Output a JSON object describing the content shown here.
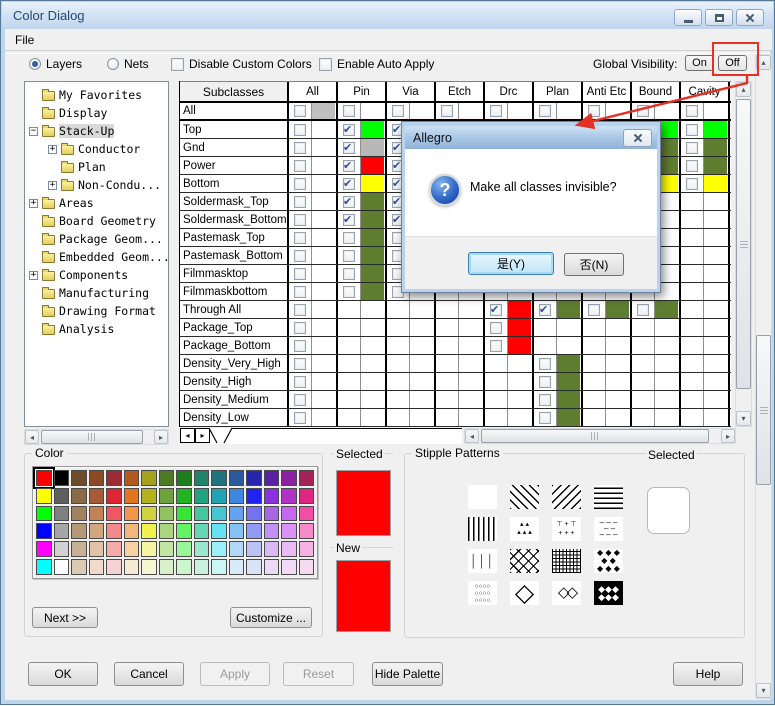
{
  "window": {
    "title": "Color Dialog",
    "menu": [
      "File"
    ]
  },
  "toolbar": {
    "radios": [
      {
        "label": "Layers",
        "selected": true
      },
      {
        "label": "Nets",
        "selected": false
      }
    ],
    "checkboxes": [
      {
        "label": "Disable Custom Colors",
        "checked": false
      },
      {
        "label": "Enable Auto Apply",
        "checked": false
      }
    ],
    "global_visibility_label": "Global Visibility:",
    "on_label": "On",
    "off_label": "Off"
  },
  "tree": {
    "items": [
      {
        "label": "My Favorites",
        "level": 0,
        "expand": null,
        "open": false,
        "selected": false
      },
      {
        "label": "Display",
        "level": 0,
        "expand": null,
        "open": false,
        "selected": false
      },
      {
        "label": "Stack-Up",
        "level": 0,
        "expand": "minus",
        "open": true,
        "selected": true
      },
      {
        "label": "Conductor",
        "level": 1,
        "expand": "plus",
        "open": false,
        "selected": false
      },
      {
        "label": "Plan",
        "level": 1,
        "expand": null,
        "open": false,
        "selected": false
      },
      {
        "label": "Non-Condu...",
        "level": 1,
        "expand": "plus",
        "open": false,
        "selected": false
      },
      {
        "label": "Areas",
        "level": 0,
        "expand": "plus",
        "open": false,
        "selected": false
      },
      {
        "label": "Board Geometry",
        "level": 0,
        "expand": null,
        "open": false,
        "selected": false
      },
      {
        "label": "Package Geom...",
        "level": 0,
        "expand": null,
        "open": false,
        "selected": false
      },
      {
        "label": "Embedded Geom...",
        "level": 0,
        "expand": null,
        "open": false,
        "selected": false
      },
      {
        "label": "Components",
        "level": 0,
        "expand": "plus",
        "open": false,
        "selected": false
      },
      {
        "label": "Manufacturing",
        "level": 0,
        "expand": null,
        "open": false,
        "selected": false
      },
      {
        "label": "Drawing Format",
        "level": 0,
        "expand": null,
        "open": false,
        "selected": false
      },
      {
        "label": "Analysis",
        "level": 0,
        "expand": null,
        "open": false,
        "selected": false
      }
    ]
  },
  "table": {
    "corner_header": "Subclasses",
    "columns": [
      "All",
      "Pin",
      "Via",
      "Etch",
      "Drc",
      "Plan",
      "Anti Etc",
      "Bound",
      "Cavity"
    ],
    "rows": [
      {
        "label": "All",
        "cells": {
          "All": [
            "u",
            "#c0c0c0"
          ],
          "Pin": [
            "u",
            null
          ],
          "Via": [
            "u",
            null
          ],
          "Etch": [
            "u",
            null
          ],
          "Drc": [
            "u",
            null
          ],
          "Plan": [
            "u",
            null
          ],
          "Anti Etc": [
            "u",
            null
          ],
          "Bound": [
            "u",
            null
          ],
          "Cavity": [
            "u",
            null
          ]
        }
      },
      {
        "label": "Top",
        "cells": {
          "All": [
            "u",
            null
          ],
          "Pin": [
            "c",
            "#00ff00"
          ],
          "Via": [
            "c",
            null
          ],
          "Bound": [
            null,
            "#00ff00"
          ],
          "Cavity": [
            "u",
            "#00ff00"
          ]
        }
      },
      {
        "label": "Gnd",
        "cells": {
          "All": [
            "u",
            null
          ],
          "Pin": [
            "c",
            "#b8b8b8"
          ],
          "Via": [
            "c",
            null
          ],
          "Bound": [
            null,
            "#5f7d2f"
          ],
          "Cavity": [
            "u",
            "#5f7d2f"
          ]
        }
      },
      {
        "label": "Power",
        "cells": {
          "All": [
            "u",
            null
          ],
          "Pin": [
            "c",
            "#ff0000"
          ],
          "Via": [
            "c",
            null
          ],
          "Bound": [
            null,
            "#5f7d2f"
          ],
          "Cavity": [
            "u",
            "#5f7d2f"
          ]
        }
      },
      {
        "label": "Bottom",
        "cells": {
          "All": [
            "u",
            null
          ],
          "Pin": [
            "c",
            "#ffff00"
          ],
          "Via": [
            "c",
            null
          ],
          "Bound": [
            null,
            "#ffff00"
          ],
          "Cavity": [
            "u",
            "#ffff00"
          ]
        }
      },
      {
        "label": "Soldermask_Top",
        "cells": {
          "All": [
            "u",
            null
          ],
          "Pin": [
            "c",
            "#5f7d2f"
          ],
          "Via": [
            "c",
            null
          ]
        }
      },
      {
        "label": "Soldermask_Bottom",
        "cells": {
          "All": [
            "u",
            null
          ],
          "Pin": [
            "c",
            "#5f7d2f"
          ],
          "Via": [
            "c",
            null
          ]
        }
      },
      {
        "label": "Pastemask_Top",
        "cells": {
          "All": [
            "u",
            null
          ],
          "Pin": [
            "u",
            "#5f7d2f"
          ],
          "Via": [
            "u",
            null
          ]
        }
      },
      {
        "label": "Pastemask_Bottom",
        "cells": {
          "All": [
            "u",
            null
          ],
          "Pin": [
            "u",
            "#5f7d2f"
          ],
          "Via": [
            "u",
            null
          ]
        }
      },
      {
        "label": "Filmmasktop",
        "cells": {
          "All": [
            "u",
            null
          ],
          "Pin": [
            "u",
            "#5f7d2f"
          ],
          "Via": [
            "u",
            null
          ]
        }
      },
      {
        "label": "Filmmaskbottom",
        "cells": {
          "All": [
            "u",
            null
          ],
          "Pin": [
            "u",
            "#5f7d2f"
          ],
          "Via": [
            "u",
            null
          ]
        }
      },
      {
        "label": "Through All",
        "cells": {
          "All": [
            "u",
            null
          ],
          "Drc": [
            "c",
            "#ff0000"
          ],
          "Plan": [
            "c",
            "#5f7d2f"
          ],
          "Anti Etc": [
            "u",
            "#5f7d2f"
          ],
          "Bound": [
            "u",
            "#5f7d2f"
          ]
        }
      },
      {
        "label": "Package_Top",
        "cells": {
          "All": [
            "u",
            null
          ],
          "Drc": [
            "u",
            "#ff0000"
          ]
        }
      },
      {
        "label": "Package_Bottom",
        "cells": {
          "All": [
            "u",
            null
          ],
          "Drc": [
            "u",
            "#ff0000"
          ]
        }
      },
      {
        "label": "Density_Very_High",
        "cells": {
          "All": [
            "u",
            null
          ],
          "Plan": [
            "u",
            "#5f7d2f"
          ]
        }
      },
      {
        "label": "Density_High",
        "cells": {
          "All": [
            "u",
            null
          ],
          "Plan": [
            "u",
            "#5f7d2f"
          ]
        }
      },
      {
        "label": "Density_Medium",
        "cells": {
          "All": [
            "u",
            null
          ],
          "Plan": [
            "u",
            "#5f7d2f"
          ]
        }
      },
      {
        "label": "Density_Low",
        "cells": {
          "All": [
            "u",
            null
          ],
          "Plan": [
            "u",
            "#5f7d2f"
          ]
        }
      }
    ]
  },
  "dialog": {
    "title": "Allegro",
    "message": "Make all classes invisible?",
    "yes_label": "是(Y)",
    "no_label": "否(N)"
  },
  "palette": {
    "group_label": "Color",
    "selected_label": "Selected",
    "new_label": "New",
    "selected_color": "#ff0000",
    "new_color": "#ff0000",
    "selected_index": 0,
    "next_label": "Next >>",
    "customize_label": "Customize ...",
    "rows": [
      [
        "#ff0000",
        "#000000",
        "#6e4b2a",
        "#8a4a26",
        "#9e2a33",
        "#b25a1e",
        "#a2a21e",
        "#4e7a26",
        "#1e7e1e",
        "#22826a",
        "#22727e",
        "#2a5a9a",
        "#2626ae",
        "#5a22a2",
        "#8a22a2",
        "#a22456"
      ],
      [
        "#ffff00",
        "#5e5e5e",
        "#8a6a46",
        "#a65a36",
        "#de2630",
        "#e2761e",
        "#b2b21e",
        "#6ea23e",
        "#22b222",
        "#22a27e",
        "#22a2b2",
        "#3e86de",
        "#2222ee",
        "#8a32de",
        "#ae32c6",
        "#de2682"
      ],
      [
        "#00ff00",
        "#808080",
        "#a2825e",
        "#c28256",
        "#f25662",
        "#f2964a",
        "#d2d23e",
        "#92c25e",
        "#36e636",
        "#46c69e",
        "#46c6d2",
        "#66a2f2",
        "#7272f2",
        "#a666e6",
        "#c666f2",
        "#f24ea6"
      ],
      [
        "#0000ff",
        "#a6a6a6",
        "#b69a76",
        "#d2a67e",
        "#f28a8a",
        "#f2b67e",
        "#f2f24e",
        "#aad682",
        "#66f266",
        "#66d6b6",
        "#66e2f2",
        "#86c2f6",
        "#929af6",
        "#c292f2",
        "#da92f6",
        "#f68aca"
      ],
      [
        "#ff00ff",
        "#d2d2d2",
        "#c6b096",
        "#e2c2a6",
        "#f6aaaa",
        "#f6d2a2",
        "#f6f6a2",
        "#c2e6a2",
        "#9af69a",
        "#9ae6ce",
        "#9af0f6",
        "#b2d6f6",
        "#bac2f6",
        "#dabaf6",
        "#eabaf6",
        "#f6b2e2"
      ],
      [
        "#00ffff",
        "#ffffff",
        "#dacab2",
        "#f2daca",
        "#f6d2d2",
        "#f6ead2",
        "#f6f6d2",
        "#daf0ca",
        "#caf6ca",
        "#caf0e2",
        "#caf6f6",
        "#daeaf6",
        "#dae2f6",
        "#eadaf6",
        "#f2daf6",
        "#f6daf0"
      ]
    ]
  },
  "stipple": {
    "group_label": "Stipple Patterns",
    "selected_label": "Selected",
    "patterns": [
      "solid",
      "diag-back",
      "diag-fwd",
      "h-lines",
      "v-lines",
      "triangles",
      "plus-t",
      "dashes",
      "v-dashes",
      "cross-diag",
      "grid",
      "diamonds",
      "circles",
      "big-diamond",
      "diamond-lattice",
      "inv-diamonds"
    ]
  },
  "footer": {
    "buttons": [
      {
        "label": "OK",
        "enabled": true
      },
      {
        "label": "Cancel",
        "enabled": true
      },
      {
        "label": "Apply",
        "enabled": false
      },
      {
        "label": "Reset",
        "enabled": false
      },
      {
        "label": "Hide Palette",
        "enabled": true
      },
      {
        "label": "Help",
        "enabled": true
      }
    ]
  }
}
